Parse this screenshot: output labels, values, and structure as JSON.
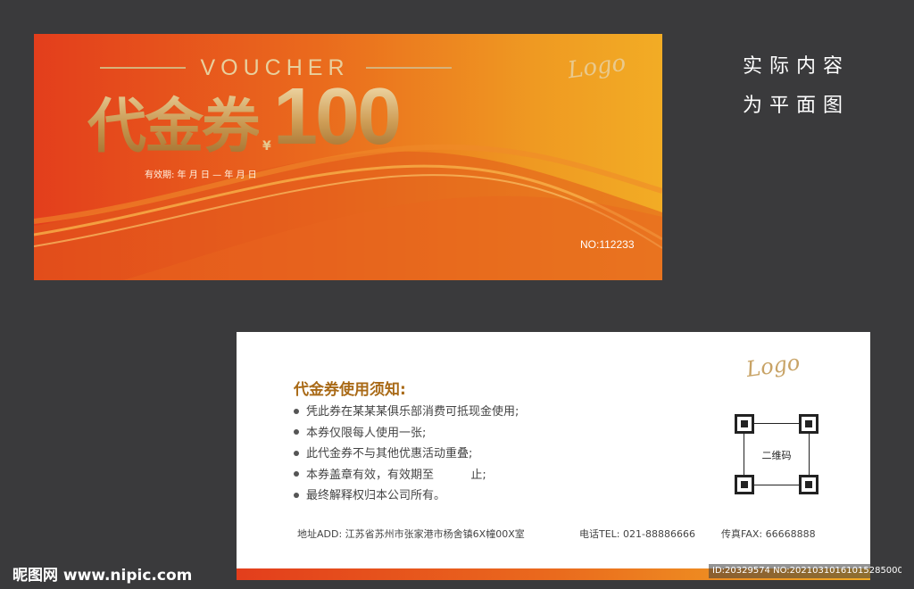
{
  "front": {
    "voucher_word": "VOUCHER",
    "title_cn": "代金券",
    "currency": "¥",
    "amount": "100",
    "validity": "有效期:    年  月  日 —   年  月  日",
    "logo": "Logo",
    "serial": "NO:112233"
  },
  "note": {
    "line1": "实际内容",
    "line2": "为平面图"
  },
  "back": {
    "logo": "Logo",
    "terms_title": "代金券使用须知:",
    "terms": [
      "凭此券在某某某俱乐部消费可抵现金使用;",
      "本券仅限每人使用一张;",
      "此代金券不与其他优惠活动重叠;",
      "本券盖章有效，有效期至          止;",
      "最终解释权归本公司所有。"
    ],
    "qr_label": "二维码",
    "address": "地址ADD: 江苏省苏州市张家港市杨舍镇6X幢00X室",
    "phone": "电话TEL: 021-88886666",
    "fax": "传真FAX: 66668888"
  },
  "watermark": {
    "site": "昵图网 www.nipic.com",
    "id_line": "ID:20329574 NO:20210310161015285000"
  },
  "colors": {
    "front_start": "#e33e1c",
    "front_end": "#f2ac25",
    "gold": "#c8a366",
    "background": "#3a3a3c"
  }
}
